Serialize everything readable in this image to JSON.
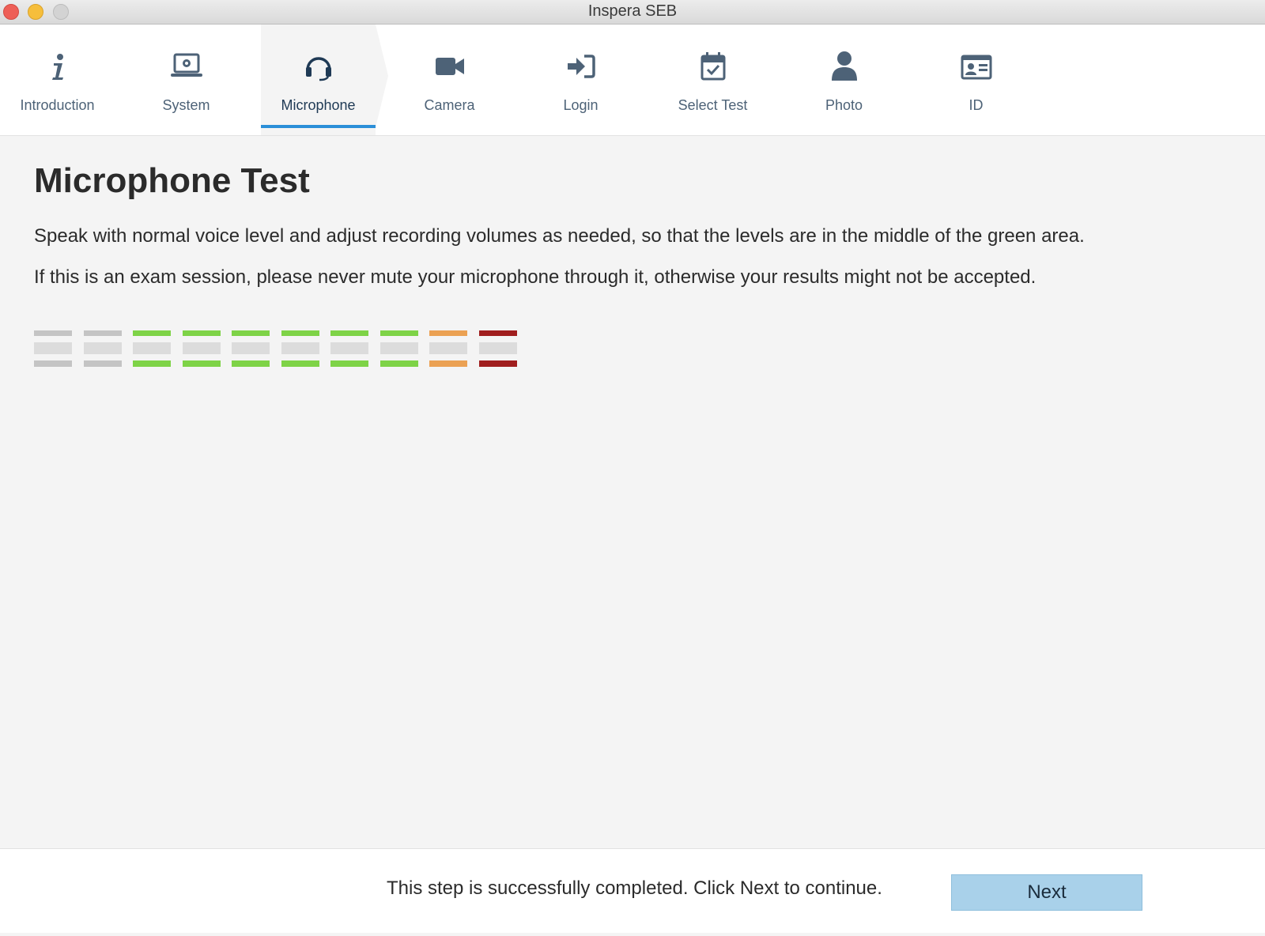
{
  "window": {
    "title": "Inspera SEB"
  },
  "nav": {
    "active_index": 2,
    "steps": [
      {
        "label": "Introduction",
        "icon": "info-icon"
      },
      {
        "label": "System",
        "icon": "laptop-settings-icon"
      },
      {
        "label": "Microphone",
        "icon": "headset-icon"
      },
      {
        "label": "Camera",
        "icon": "video-camera-icon"
      },
      {
        "label": "Login",
        "icon": "sign-in-icon"
      },
      {
        "label": "Select Test",
        "icon": "calendar-check-icon"
      },
      {
        "label": "Photo",
        "icon": "user-icon"
      },
      {
        "label": "ID",
        "icon": "id-card-icon"
      }
    ]
  },
  "main": {
    "heading": "Microphone Test",
    "paragraph1": "Speak with normal voice level and adjust recording volumes as needed, so that the levels are in the middle of the green area.",
    "paragraph2": "If this is an exam session, please never mute your microphone through it, otherwise your results might not be accepted."
  },
  "level_meter": {
    "segment_count": 10,
    "segment_colors": [
      "#c4c4c4",
      "#c4c4c4",
      "#7ed347",
      "#7ed347",
      "#7ed347",
      "#7ed347",
      "#7ed347",
      "#7ed347",
      "#eba153",
      "#a01e1e"
    ],
    "middle_color": "#dcdcdc"
  },
  "footer": {
    "status_text": "This step is successfully completed. Click Next to continue.",
    "next_label": "Next"
  },
  "colors": {
    "accent": "#2b8fd8",
    "next_button": "#a9d1ea",
    "nav_icon": "#4d6277"
  }
}
